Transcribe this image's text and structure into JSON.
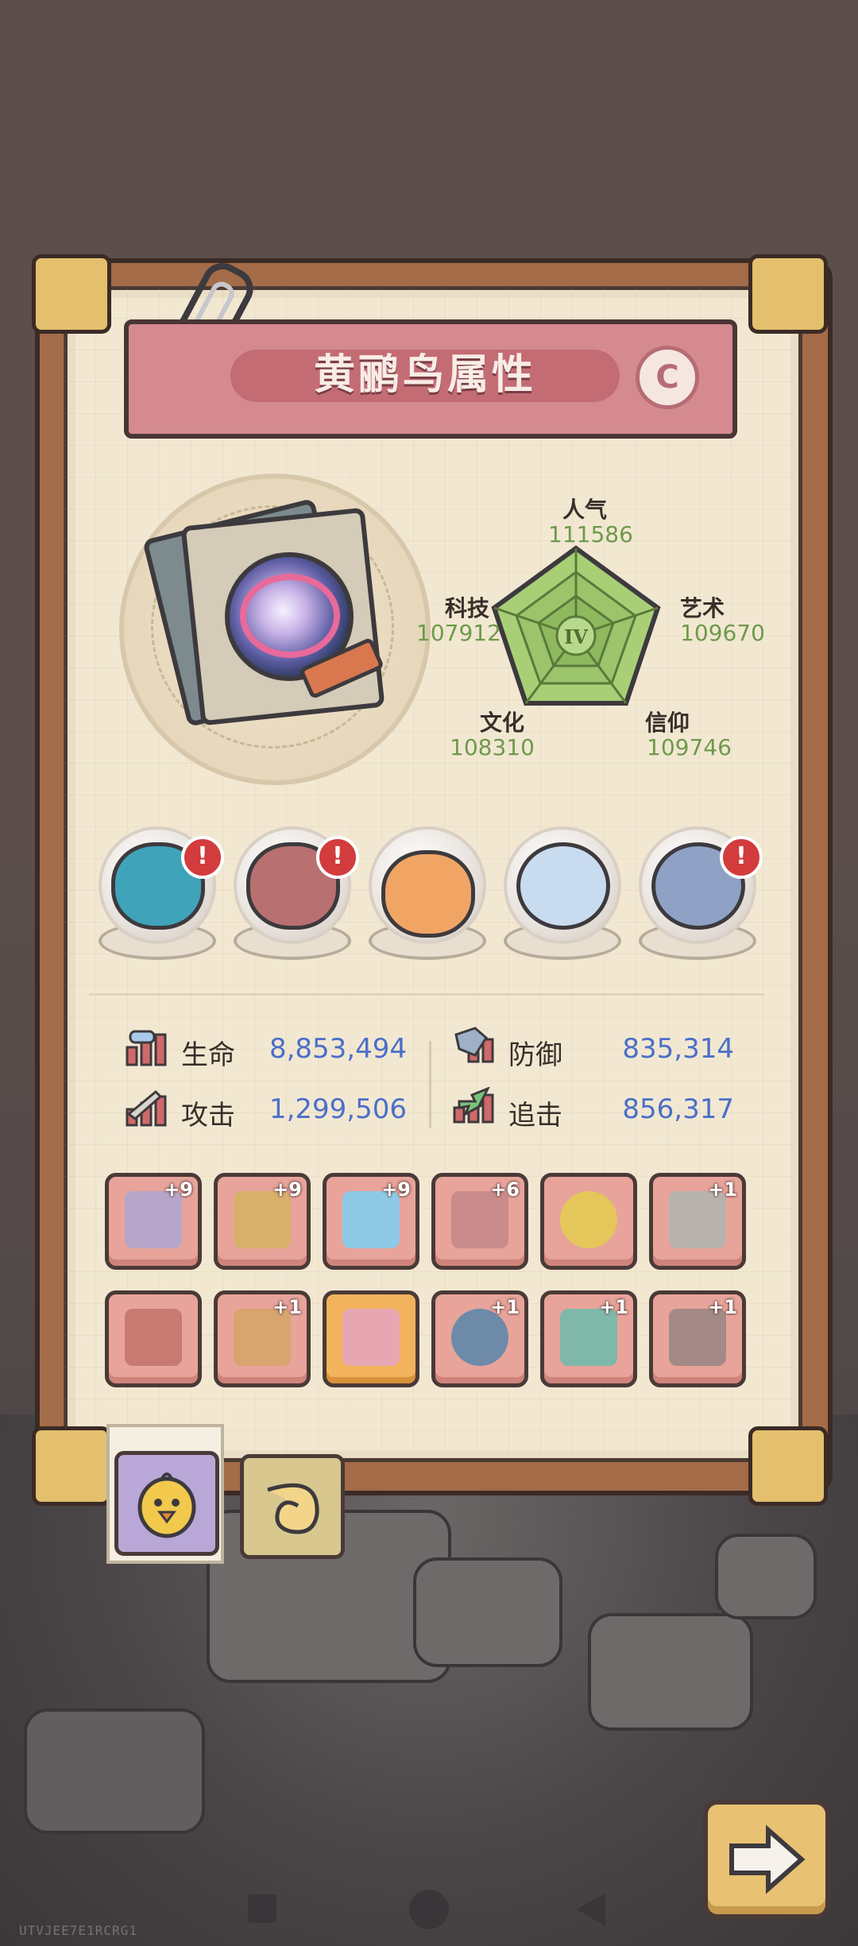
{
  "title": "黄鹂鸟属性",
  "grade": "C",
  "radar": {
    "center_label": "IV",
    "stats": [
      {
        "name": "人气",
        "value": "111586"
      },
      {
        "name": "艺术",
        "value": "109670"
      },
      {
        "name": "信仰",
        "value": "109746"
      },
      {
        "name": "文化",
        "value": "108310"
      },
      {
        "name": "科技",
        "value": "107912"
      }
    ]
  },
  "monsters": [
    {
      "icon": "piranha-monster-icon",
      "alert": "!"
    },
    {
      "icon": "fang-beast-icon",
      "alert": "!"
    },
    {
      "icon": "sleeping-pig-icon",
      "alert": ""
    },
    {
      "icon": "compass-icon",
      "alert": ""
    },
    {
      "icon": "gem-ring-icon",
      "alert": "!"
    }
  ],
  "attributes": {
    "hp": {
      "label": "生命",
      "value": "8,853,494"
    },
    "defense": {
      "label": "防御",
      "value": "835,314"
    },
    "attack": {
      "label": "攻击",
      "value": "1,299,506"
    },
    "pursuit": {
      "label": "追击",
      "value": "856,317"
    }
  },
  "equipment": [
    {
      "icon": "chain-armor-icon",
      "plus": "+9"
    },
    {
      "icon": "slingshot-icon",
      "plus": "+9"
    },
    {
      "icon": "sword-icon",
      "plus": "+9"
    },
    {
      "icon": "drill-sword-icon",
      "plus": "+6"
    },
    {
      "icon": "golden-ring-icon",
      "plus": ""
    },
    {
      "icon": "staff-icon",
      "plus": "+1"
    },
    {
      "icon": "device-icon",
      "plus": ""
    },
    {
      "icon": "mech-armor-icon",
      "plus": "+1"
    },
    {
      "icon": "vest-icon",
      "plus": ""
    },
    {
      "icon": "bracelet-icon",
      "plus": "+1"
    },
    {
      "icon": "scepter-icon",
      "plus": "+1"
    },
    {
      "icon": "dagger-icon",
      "plus": "+1"
    }
  ],
  "tabs": [
    {
      "icon": "chick-icon"
    },
    {
      "icon": "shell-icon"
    }
  ],
  "watermark": "UTVJEE7E1RCRG1",
  "colors": {
    "accent_value": "#4b6fc9",
    "radar_value": "#6e9a4a",
    "title_banner": "#d48a8e",
    "slot": "#e8a49a"
  }
}
